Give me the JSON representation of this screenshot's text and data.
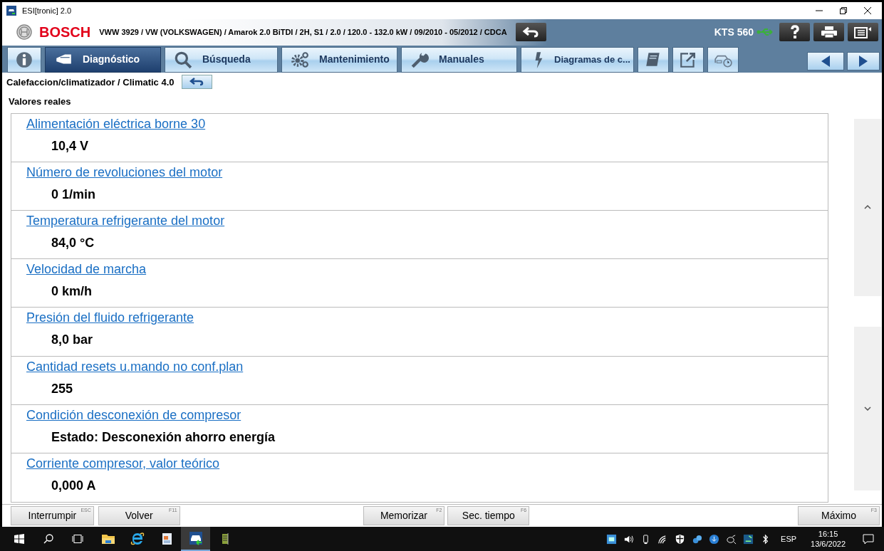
{
  "window": {
    "title": "ESI[tronic] 2.0"
  },
  "header": {
    "brand": "BOSCH",
    "vehicle": "VWW 3929 / VW (VOLKSWAGEN) / Amarok 2.0 BiTDI / 2H, S1 / 2.0 / 120.0 - 132.0 kW / 09/2010 - 05/2012 / CDCA",
    "device": "KTS 560"
  },
  "tabs": [
    {
      "kind": "info",
      "selected": false
    },
    {
      "kind": "diag",
      "label": "Diagnóstico",
      "selected": true
    },
    {
      "kind": "search",
      "label": "Búsqueda",
      "selected": false
    },
    {
      "kind": "gears",
      "label": "Mantenimiento",
      "selected": false
    },
    {
      "kind": "wrench",
      "label": "Manuales",
      "selected": false
    },
    {
      "kind": "bolt",
      "label": "Diagramas de c...",
      "selected": false
    },
    {
      "kind": "book",
      "selected": false
    },
    {
      "kind": "export",
      "selected": false
    },
    {
      "kind": "car",
      "selected": false
    }
  ],
  "breadcrumb": "Calefaccion/climatizador / Climatic 4.0",
  "section_title": "Valores reales",
  "values": [
    {
      "label": "Alimentación eléctrica borne 30",
      "value": "10,4 V"
    },
    {
      "label": "Número de revoluciones del motor",
      "value": "0 1/min"
    },
    {
      "label": "Temperatura refrigerante del motor",
      "value": "84,0 °C"
    },
    {
      "label": "Velocidad de marcha",
      "value": "0 km/h"
    },
    {
      "label": "Presión del fluido refrigerante",
      "value": "8,0 bar"
    },
    {
      "label": "Cantidad resets u.mando no conf.plan",
      "value": "255"
    },
    {
      "label": "Condición desconexión de compresor",
      "value": "Estado: Desconexión ahorro energía"
    },
    {
      "label": "Corriente compresor, valor teórico",
      "value": "0,000 A"
    }
  ],
  "footer_buttons": [
    {
      "label": "Interrumpir",
      "key": "ESC"
    },
    {
      "label": "Volver",
      "key": "F11"
    },
    {
      "label": "Memorizar",
      "key": "F2"
    },
    {
      "label": "Sec. tiempo",
      "key": "F6"
    },
    {
      "label": "Máximo",
      "key": "F3"
    }
  ],
  "taskbar": {
    "apps": [
      {
        "kind": "folder",
        "selected": false
      },
      {
        "kind": "ie",
        "selected": false
      },
      {
        "kind": "doc",
        "selected": false
      },
      {
        "kind": "esi",
        "selected": true
      },
      {
        "kind": "cart",
        "selected": false
      }
    ],
    "language": "ESP",
    "time": "16:15",
    "date": "13/6/2022"
  }
}
